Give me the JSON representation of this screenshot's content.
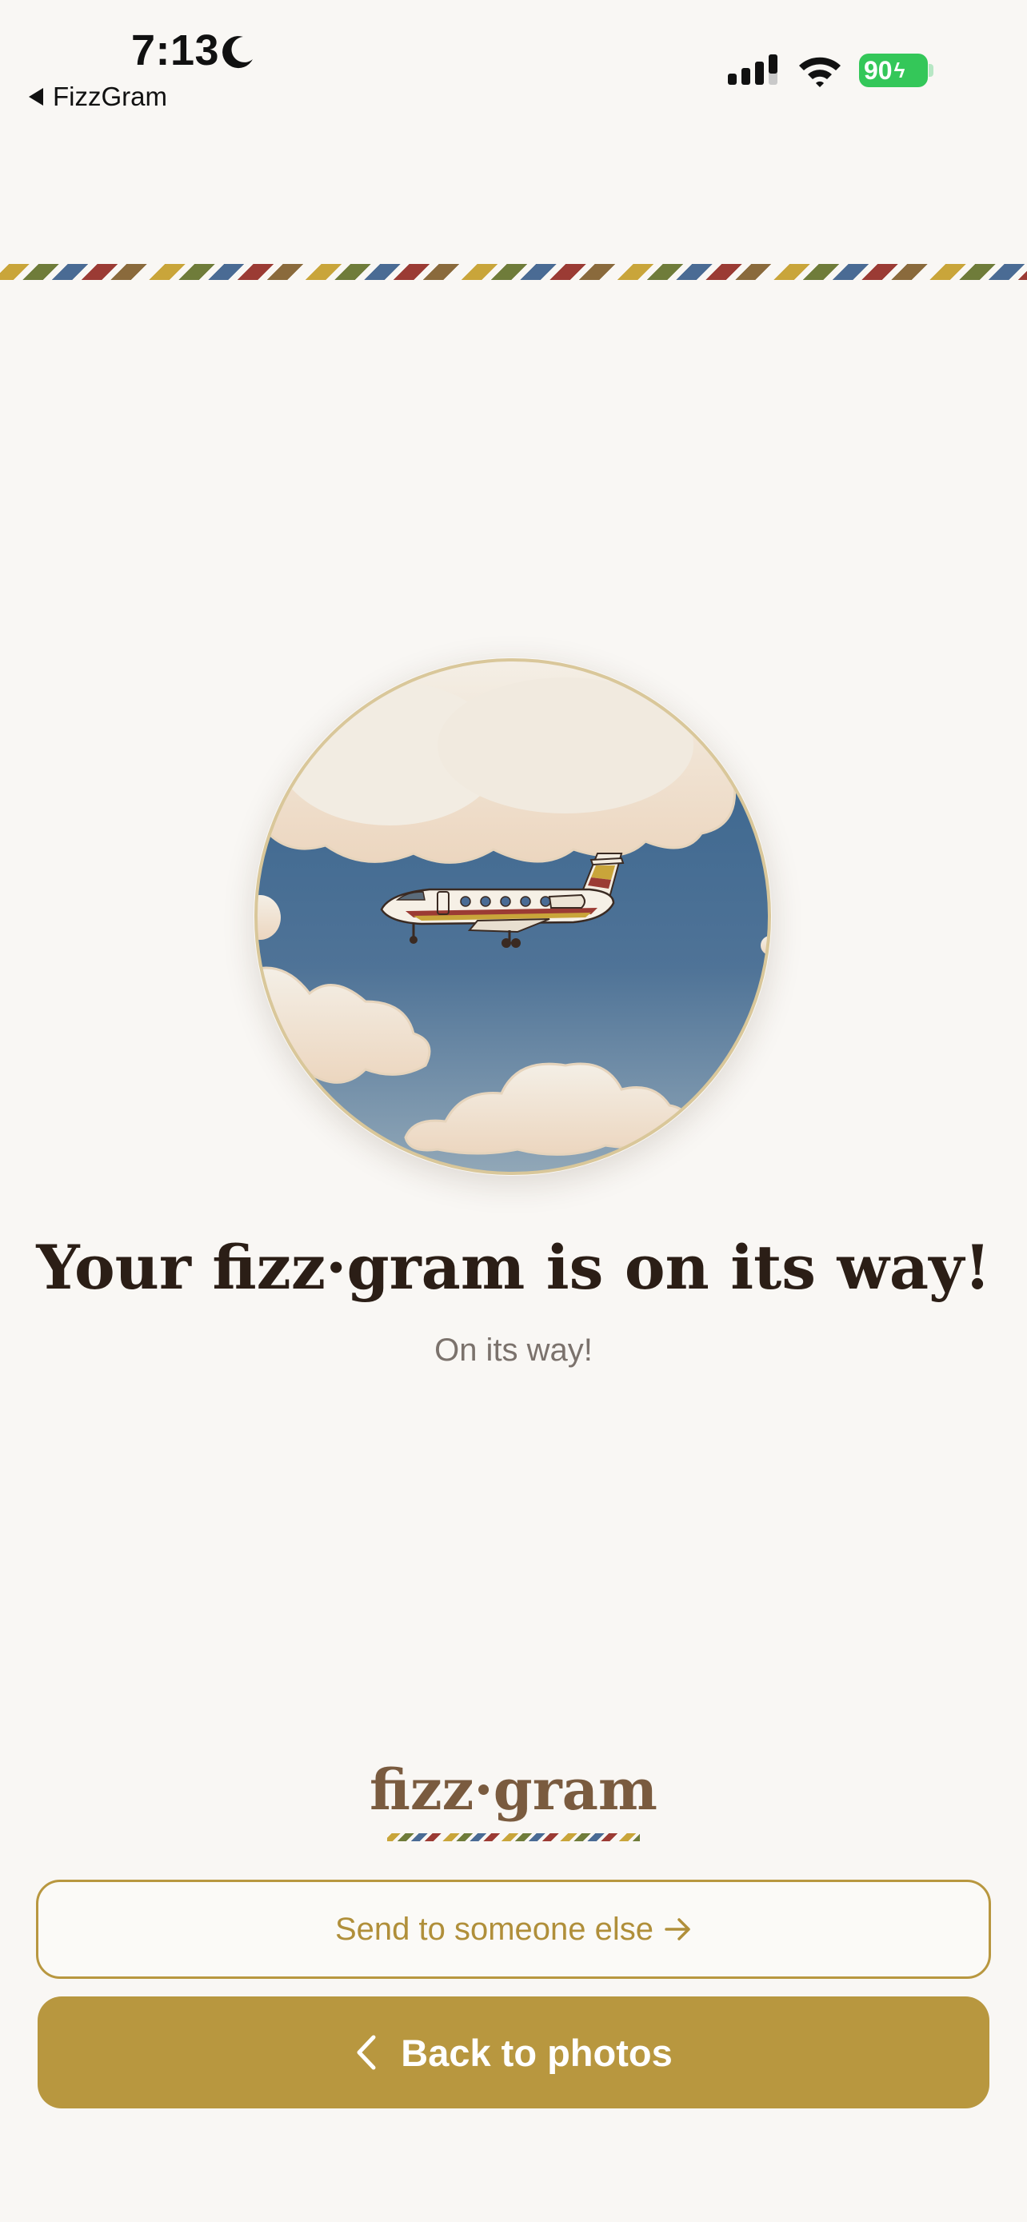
{
  "status_bar": {
    "time": "7:13",
    "back_app_label": "FizzGram",
    "battery_percent": "90",
    "icons": [
      "moon-icon",
      "cellular-signal-icon",
      "wifi-icon",
      "battery-charging-icon"
    ]
  },
  "colors": {
    "background": "#f9f7f4",
    "accent_gold": "#b8973f",
    "headline": "#2b1e16",
    "subtext": "#7b726c",
    "logo": "#7a5b3f",
    "sky": "#4f7397",
    "stripe": [
      "#c9a53a",
      "#6f7c3a",
      "#4a6b94",
      "#9b3b34",
      "#8a6a3c"
    ]
  },
  "main": {
    "headline": "Your fizz·gram is on its way!",
    "subhead": "On its way!",
    "illustration": "airplane-in-clouds"
  },
  "brand": {
    "logo_text": "fizz·gram"
  },
  "actions": {
    "send_again_label": "Send to someone else",
    "send_again_icon": "arrow-right-icon",
    "back_label": "Back to photos",
    "back_icon": "chevron-left-icon"
  }
}
